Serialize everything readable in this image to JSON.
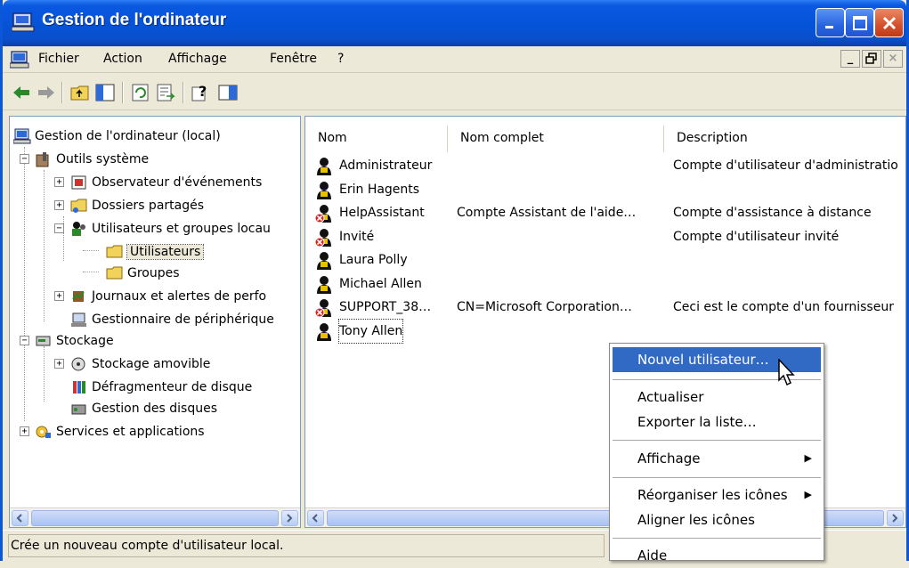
{
  "window": {
    "title": "Gestion de l'ordinateur",
    "controls": [
      "minimize",
      "maximize",
      "close"
    ]
  },
  "menubar": {
    "items": [
      "Fichier",
      "Action",
      "Affichage",
      "Fenêtre",
      "?"
    ]
  },
  "toolbar": {
    "icons": [
      "back-arrow-icon",
      "forward-arrow-icon",
      "up-folder-icon",
      "show-tree-icon",
      "refresh-icon",
      "export-list-icon",
      "help-icon",
      "show-hide-action-pane-icon"
    ]
  },
  "tree": {
    "root": "Gestion de l'ordinateur (local)",
    "outils": "Outils système",
    "observateur": "Observateur d'événements",
    "dossiers": "Dossiers partagés",
    "utilisateurs_groupes": "Utilisateurs et groupes locau",
    "utilisateurs": "Utilisateurs",
    "groupes": "Groupes",
    "journaux": "Journaux et alertes de perfo",
    "gestionnaire": "Gestionnaire de périphérique",
    "stockage": "Stockage",
    "stockage_amovible": "Stockage amovible",
    "defrag": "Défragmenteur de disque",
    "gestion_disques": "Gestion des disques",
    "services": "Services et applications"
  },
  "list": {
    "columns": [
      "Nom",
      "Nom complet",
      "Description"
    ],
    "rows": [
      {
        "name": "Administrateur",
        "full": "",
        "desc": "Compte d'utilisateur d'administratio",
        "disabled": false
      },
      {
        "name": "Erin Hagents",
        "full": "",
        "desc": "",
        "disabled": false
      },
      {
        "name": "HelpAssistant",
        "full": "Compte Assistant de l'aide…",
        "desc": "Compte d'assistance à distance",
        "disabled": true
      },
      {
        "name": "Invité",
        "full": "",
        "desc": "Compte d'utilisateur invité",
        "disabled": true
      },
      {
        "name": "Laura Polly",
        "full": "",
        "desc": "",
        "disabled": false
      },
      {
        "name": "Michael Allen",
        "full": "",
        "desc": "",
        "disabled": false
      },
      {
        "name": "SUPPORT_38…",
        "full": "CN=Microsoft Corporation…",
        "desc": "Ceci est le compte d'un fournisseur",
        "disabled": true
      },
      {
        "name": "Tony Allen",
        "full": "",
        "desc": "",
        "disabled": false
      }
    ]
  },
  "context_menu": {
    "new_user": "Nouvel utilisateur…",
    "refresh": "Actualiser",
    "export": "Exporter la liste…",
    "view": "Affichage",
    "arrange": "Réorganiser les icônes",
    "align": "Aligner les icônes",
    "help": "Aide"
  },
  "status": {
    "text": "Crée un nouveau compte d'utilisateur local."
  },
  "colors": {
    "titlebar": "#0554d8",
    "menu_highlight": "#316ac5",
    "window_bg": "#ece9d8"
  }
}
